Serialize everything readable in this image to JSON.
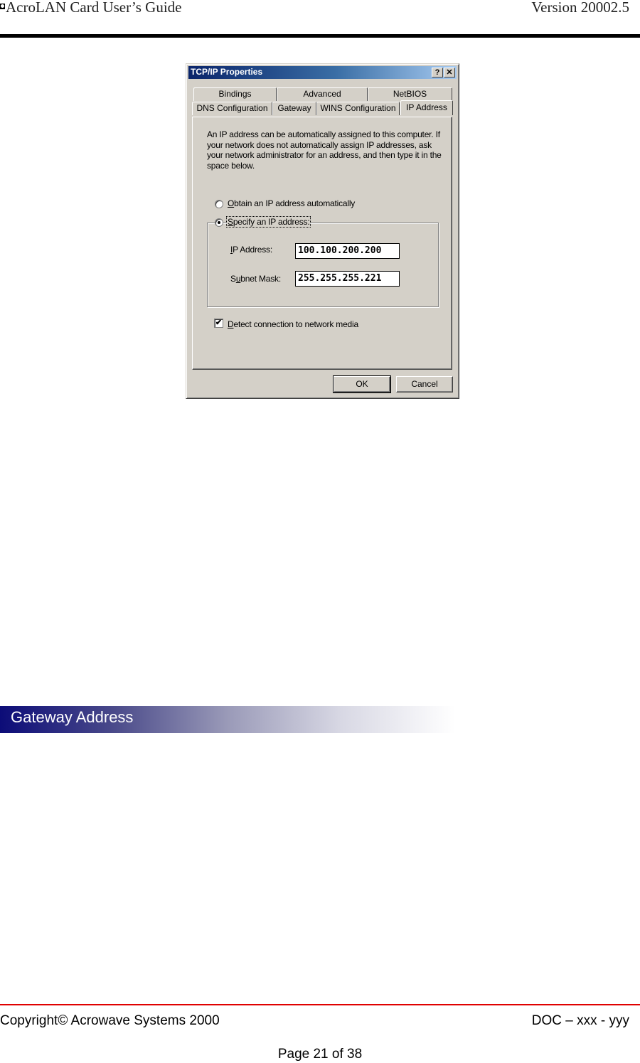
{
  "header": {
    "title": "AcroLAN Card User’s Guide",
    "version": "Version 20002.5"
  },
  "dialog": {
    "title": "TCP/IP Properties",
    "help_button": "?",
    "close_button": "✕",
    "tabs_back_row": [
      {
        "label": "Bindings"
      },
      {
        "label": "Advanced"
      },
      {
        "label": "NetBIOS"
      }
    ],
    "tabs_front_row": [
      {
        "label": "DNS Configuration"
      },
      {
        "label": "Gateway"
      },
      {
        "label": "WINS Configuration"
      },
      {
        "label": "IP Address",
        "active": true
      }
    ],
    "description": "An IP address can be automatically assigned to this computer. If your network does not automatically assign IP addresses, ask your network administrator for an address, and then type it in the space below.",
    "options": {
      "obtain_auto": {
        "label_accel": "O",
        "label_rest": "btain an IP address automatically",
        "selected": false
      },
      "specify": {
        "label_accel": "S",
        "label_rest": "pecify an IP address:",
        "selected": true
      }
    },
    "fields": {
      "ip_address": {
        "label_accel": "I",
        "label_rest": "P Address:",
        "value": "100.100.200.200"
      },
      "subnet_mask": {
        "label_pre": "S",
        "label_accel": "u",
        "label_rest": "bnet Mask:",
        "value": "255.255.255.221"
      }
    },
    "detect": {
      "label_accel": "D",
      "label_rest": "etect connection to network media",
      "checked": true,
      "check_glyph": "✔"
    },
    "buttons": {
      "ok": "OK",
      "cancel": "Cancel"
    }
  },
  "section": {
    "heading": "Gateway Address"
  },
  "footer": {
    "copyright": "Copyright© Acrowave Systems 2000",
    "doc_id": "DOC – xxx - yyy",
    "page": "Page 21 of 38"
  }
}
